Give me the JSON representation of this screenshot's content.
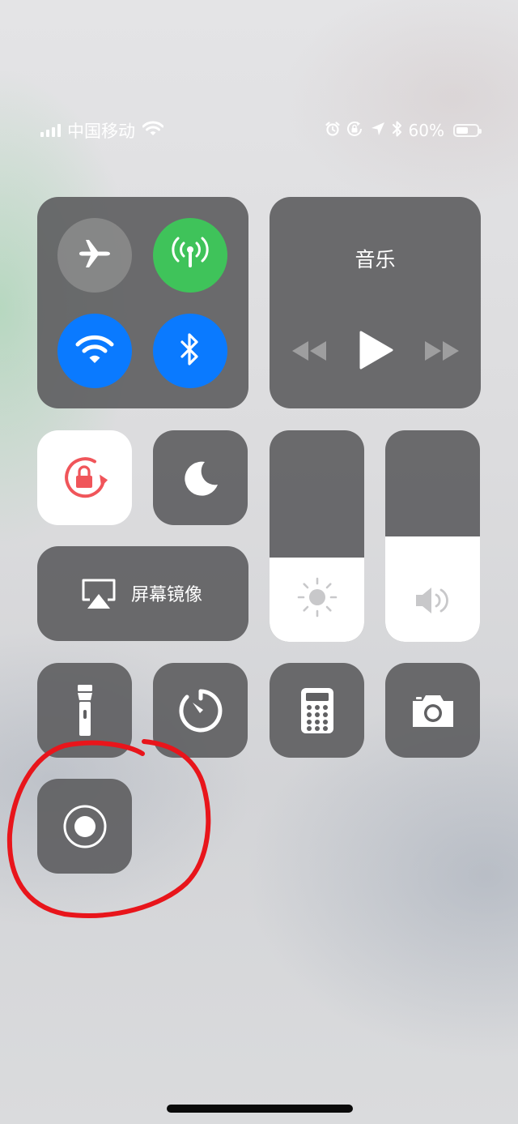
{
  "status_bar": {
    "carrier": "中国移动",
    "battery_percent": "60%",
    "battery_level": 0.6,
    "icons": [
      "signal-icon",
      "wifi-icon",
      "alarm-icon",
      "rotation-lock-icon",
      "location-icon",
      "bluetooth-icon",
      "battery-icon"
    ]
  },
  "connectivity": {
    "airplane": {
      "icon": "airplane-icon",
      "state": "off"
    },
    "cellular": {
      "icon": "cellular-antenna-icon",
      "state": "on",
      "color": "#3fc35a"
    },
    "wifi": {
      "icon": "wifi-icon",
      "state": "on",
      "color": "#0a7aff"
    },
    "bluetooth": {
      "icon": "bluetooth-icon",
      "state": "on",
      "color": "#0a7aff"
    }
  },
  "music": {
    "title": "音乐",
    "controls": [
      "rewind-icon",
      "play-icon",
      "fast-forward-icon"
    ]
  },
  "controls": {
    "rotation_lock": {
      "icon": "rotation-lock-icon",
      "state": "on",
      "color": "#f0555a"
    },
    "do_not_disturb": {
      "icon": "moon-icon",
      "state": "off"
    },
    "screen_mirroring": {
      "label": "屏幕镜像",
      "icon": "airplay-icon"
    }
  },
  "sliders": {
    "brightness": {
      "icon": "sun-icon",
      "level": 0.4
    },
    "volume": {
      "icon": "speaker-icon",
      "level": 0.5
    }
  },
  "shortcuts": [
    "flashlight-icon",
    "timer-icon",
    "calculator-icon",
    "camera-icon",
    "screen-record-icon"
  ],
  "annotation_color": "#e8151b"
}
